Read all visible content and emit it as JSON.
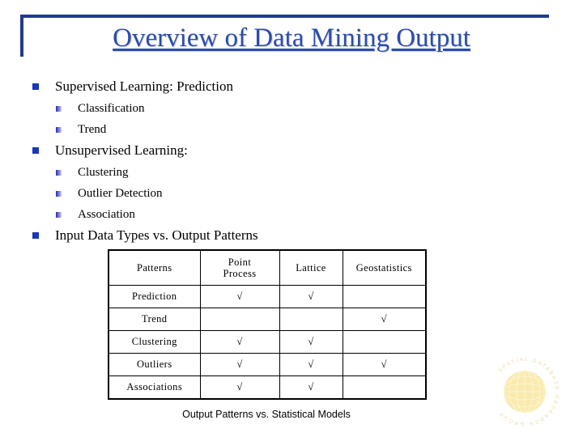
{
  "slide": {
    "title": "Overview of Data Mining Output",
    "accent_color": "#1F3C8C",
    "title_color": "#2A4CB0",
    "bullet_color": "#1838B8"
  },
  "outline": [
    {
      "label": "Supervised Learning: Prediction",
      "children": [
        "Classification",
        "Trend"
      ]
    },
    {
      "label": "Unsupervised Learning:",
      "children": [
        "Clustering",
        "Outlier Detection",
        "Association"
      ]
    },
    {
      "label": "Input Data Types vs. Output Patterns",
      "children": []
    }
  ],
  "table": {
    "headers": [
      "Patterns",
      "Point Process",
      "Lattice",
      "Geostatistics"
    ],
    "header_lines": {
      "col0": "Patterns",
      "col1_line1": "Point",
      "col1_line2": "Process",
      "col2": "Lattice",
      "col3": "Geostatistics"
    },
    "tick": "√",
    "rows": [
      {
        "label": "Prediction",
        "point_process": "√",
        "lattice": "√",
        "geostatistics": ""
      },
      {
        "label": "Trend",
        "point_process": "",
        "lattice": "",
        "geostatistics": "√"
      },
      {
        "label": "Clustering",
        "point_process": "√",
        "lattice": "√",
        "geostatistics": ""
      },
      {
        "label": "Outliers",
        "point_process": "√",
        "lattice": "√",
        "geostatistics": "√"
      },
      {
        "label": "Associations",
        "point_process": "√",
        "lattice": "√",
        "geostatistics": ""
      }
    ]
  },
  "caption": "Output Patterns vs. Statistical Models",
  "logo": {
    "text": "SPATIAL DATABASE RESEARCH GROUP",
    "globe_color": "#F5D76E",
    "ring_color": "#E8C86A"
  }
}
